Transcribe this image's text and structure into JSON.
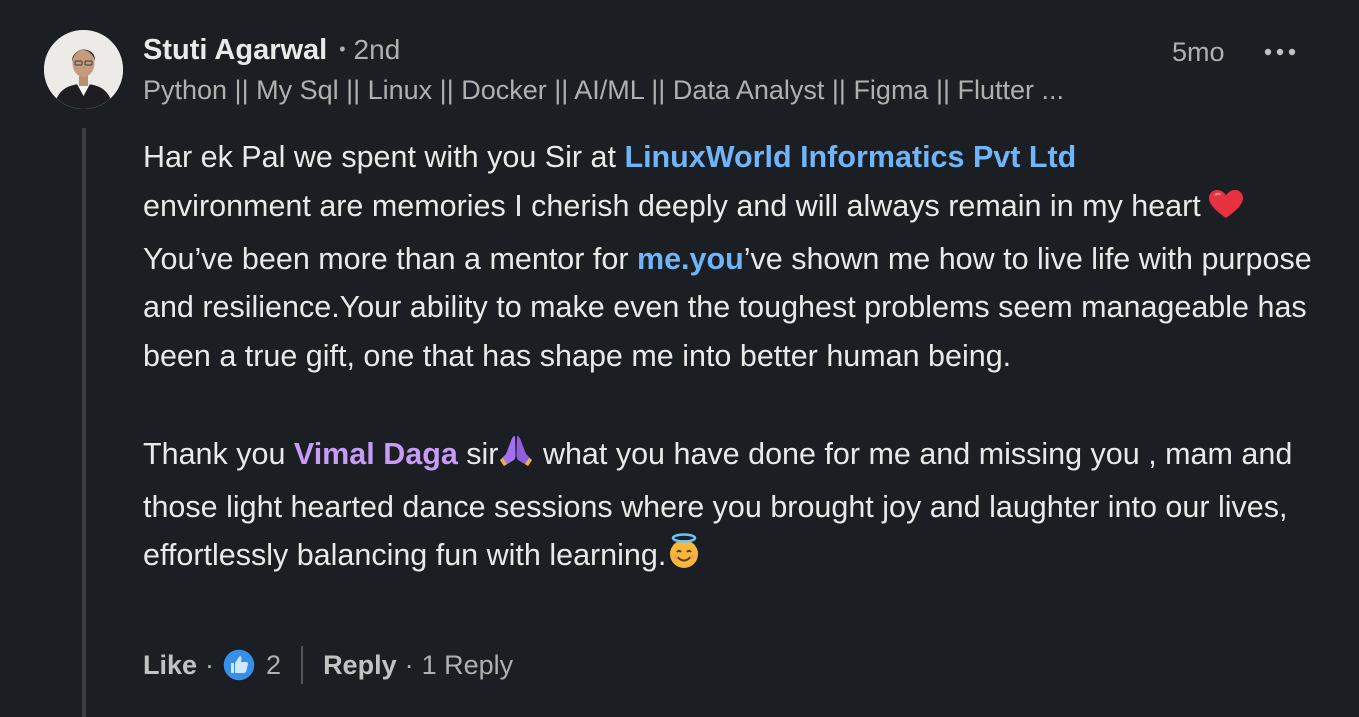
{
  "comment": {
    "author": {
      "name": "Stuti Agarwal",
      "degree": "2nd",
      "headline": "Python || My Sql || Linux || Docker || AI/ML || Data Analyst || Figma || Flutter ..."
    },
    "timestamp": "5mo",
    "body": {
      "p1": {
        "t1": "Har ek Pal we spent with you Sir at ",
        "mention_company": "LinuxWorld Informatics Pvt Ltd",
        "t2": " environment are memories I cherish deeply and will always remain in my heart  ",
        "t3": "You’ve been more than a mentor for ",
        "link": "me.you",
        "t4": "’ve shown me how to live life with purpose and resilience.Your ability to make even the toughest problems seem manageable has been a true gift, one that has shape me into better human being."
      },
      "p2": {
        "t1": "Thank you ",
        "mention_person": "Vimal Daga",
        "t2": " sir",
        "t3": "  what you have done for me and missing you , mam and those light hearted dance sessions where you brought joy and laughter into our lives, effortlessly balancing fun with learning."
      }
    },
    "actions": {
      "like_label": "Like",
      "reaction_count": "2",
      "reply_label": "Reply",
      "reply_count": "1 Reply"
    }
  },
  "colors": {
    "background": "#1b1f23",
    "link": "#70b5f9",
    "person_mention": "#c79cf6",
    "text": "#e9e9e9",
    "muted": "#b0b0b0"
  },
  "icons": {
    "avatar": "profile-photo",
    "more": "ellipsis-icon",
    "heart": "red-heart-emoji",
    "pray": "folded-hands-emoji",
    "angel": "smiling-face-with-halo-emoji",
    "reaction": "like-thumbs-up-icon"
  }
}
